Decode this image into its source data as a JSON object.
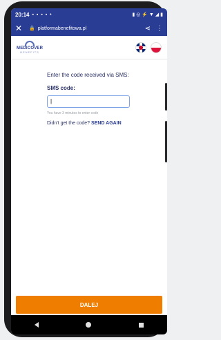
{
  "statusbar": {
    "time": "20:14",
    "notifications": "▪ ▪ ▪ ▪ •",
    "right_icons": "▮ ◎ ⚡ ▼ ◢ ▮"
  },
  "browser": {
    "url": "platformabenefitowa.pl",
    "close": "✕",
    "lock": "🔒",
    "share": "⋖",
    "more": "⋮"
  },
  "header": {
    "logo_text": "MEDICOVER",
    "logo_sub": "BENEFITS"
  },
  "content": {
    "prompt": "Enter the code received via SMS:",
    "sms_label": "SMS code:",
    "code_value": "|",
    "hint": "You have 3 minutes to enter code",
    "resend_text": "Didn't get the code?",
    "resend_link": "SEND AGAIN"
  },
  "footer": {
    "next_button": "DALEJ"
  },
  "colors": {
    "brand": "#2a3d94",
    "accent": "#ee7d00"
  }
}
